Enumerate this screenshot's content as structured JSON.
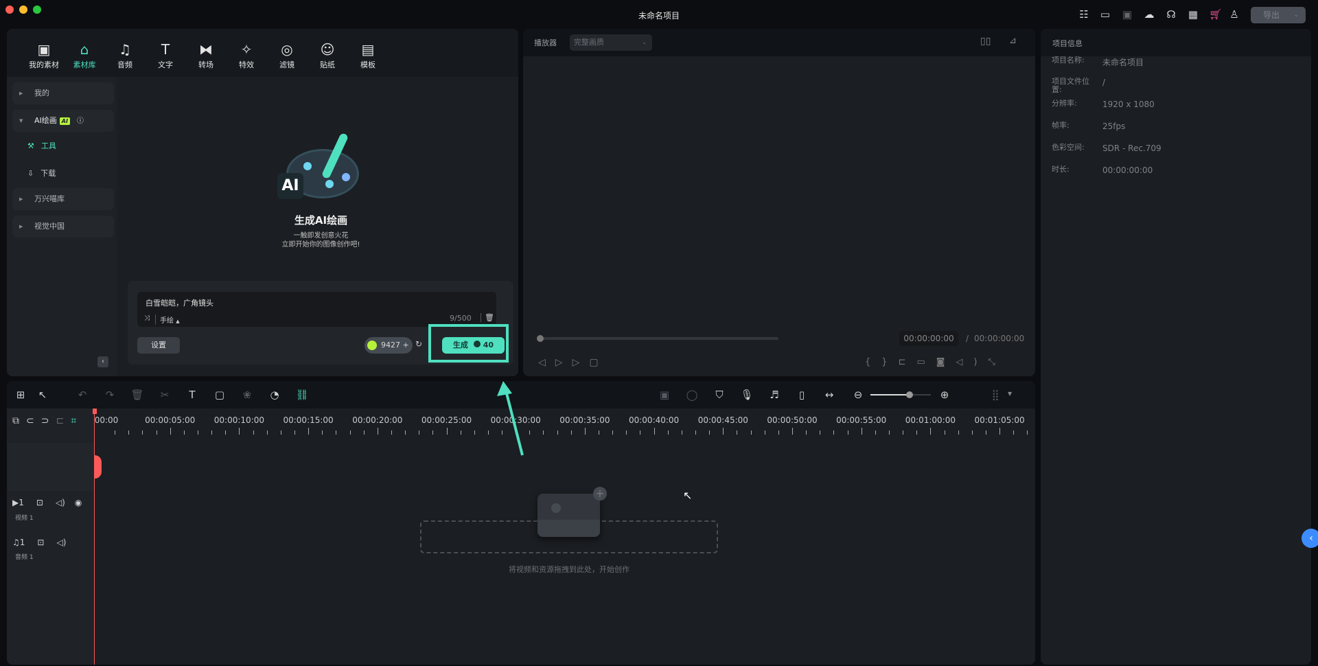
{
  "window": {
    "title": "未命名项目"
  },
  "topbar": {
    "icons": [
      "task-list-icon",
      "layout-icon",
      "save-icon",
      "cloud-upload-icon",
      "headset-icon",
      "apps-icon",
      "cart-icon",
      "user-icon"
    ],
    "export_label": "导出"
  },
  "media_tabs": [
    {
      "label": "我的素材",
      "icon": "▣"
    },
    {
      "label": "素材库",
      "icon": "⌂",
      "active": true
    },
    {
      "label": "音频",
      "icon": "♫"
    },
    {
      "label": "文字",
      "icon": "T"
    },
    {
      "label": "转场",
      "icon": "⧓"
    },
    {
      "label": "特效",
      "icon": "✧"
    },
    {
      "label": "滤镜",
      "icon": "◎"
    },
    {
      "label": "贴纸",
      "icon": "☺"
    },
    {
      "label": "模板",
      "icon": "▤"
    }
  ],
  "sidebar": {
    "mine": "我的",
    "ai_paint": "AI绘画",
    "ai_badge": "AI",
    "tools": "工具",
    "download": "下载",
    "wondershare_lib": "万兴喵库",
    "vcg": "视觉中国"
  },
  "ai_panel": {
    "logo_text": "AI",
    "title": "生成AI绘画",
    "subtitle1": "一触即发创意火花",
    "subtitle2": "立即开始你的图像创作吧!",
    "prompt": "白雪皑皑，广角镜头",
    "style": "手绘",
    "char_count": "9/500",
    "settings": "设置",
    "credits": "9427",
    "generate": "生成",
    "cost": "40"
  },
  "player": {
    "label": "播放器",
    "quality": "完整画质",
    "current_time": "00:00:00:00",
    "separator": "/",
    "total_time": "00:00:00:00",
    "progress": 0
  },
  "project_info": {
    "header": "项目信息",
    "rows": [
      {
        "label": "项目名称:",
        "value": "未命名项目"
      },
      {
        "label": "项目文件位置:",
        "value": "/"
      },
      {
        "label": "分辨率:",
        "value": "1920 x 1080"
      },
      {
        "label": "帧率:",
        "value": "25fps"
      },
      {
        "label": "色彩空间:",
        "value": "SDR - Rec.709"
      },
      {
        "label": "时长:",
        "value": "00:00:00:00"
      }
    ]
  },
  "timeline": {
    "ruler": [
      "00:00",
      "00:00:05:00",
      "00:00:10:00",
      "00:00:15:00",
      "00:00:20:00",
      "00:00:25:00",
      "00:00:30:00",
      "00:00:35:00",
      "00:00:40:00",
      "00:00:45:00",
      "00:00:50:00",
      "00:00:55:00",
      "00:01:00:00",
      "00:01:05:00"
    ],
    "video_track": {
      "num": "1",
      "name": "视频 1"
    },
    "audio_track": {
      "num": "1",
      "name": "音频 1"
    },
    "drop_hint": "将视频和资源拖拽到此处，开始创作",
    "zoom_level": 0.65
  },
  "colors": {
    "accent": "#4fe0c0",
    "playhead": "#ff5a5a",
    "ai_badge": "#b5f23a"
  }
}
